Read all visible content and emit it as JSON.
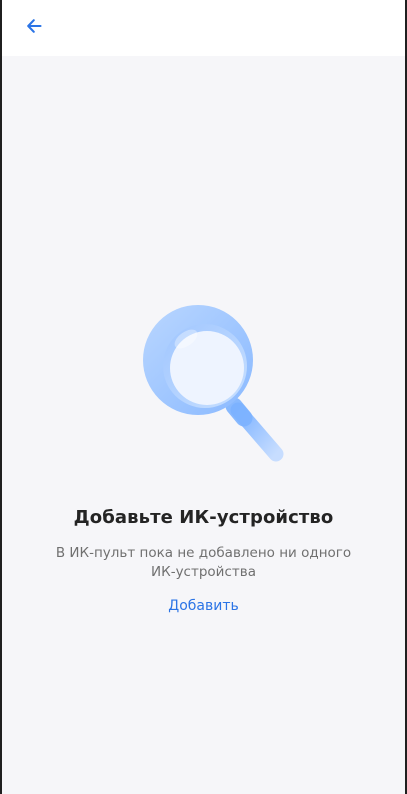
{
  "header": {
    "back_icon": "arrow-left-icon"
  },
  "empty_state": {
    "illustration_icon": "magnifier-icon",
    "title": "Добавьте ИК-устройство",
    "description": "В ИК-пульт пока не добавлено ни одного ИК-устройства",
    "action_label": "Добавить"
  },
  "colors": {
    "accent": "#2b74e6",
    "background": "#f6f6f9",
    "title": "#242424",
    "description": "#707070"
  }
}
